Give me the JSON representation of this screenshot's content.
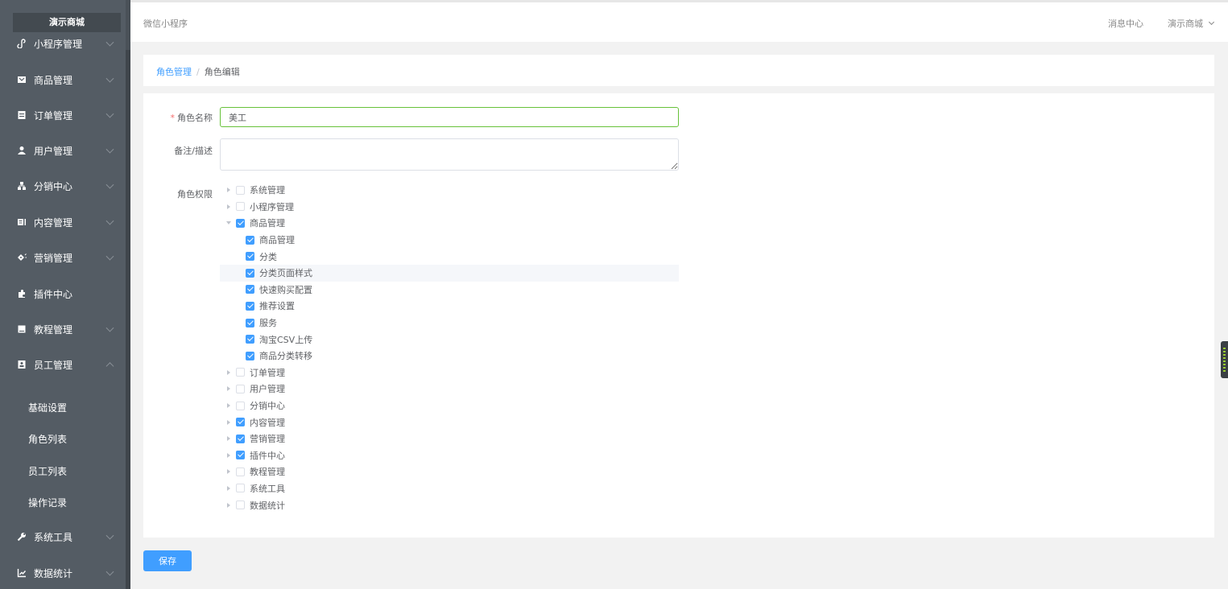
{
  "brand": "演示商城",
  "sidebar": {
    "items": [
      {
        "label": "小程序管理",
        "icon": "mini-program-icon"
      },
      {
        "label": "商品管理",
        "icon": "goods-icon"
      },
      {
        "label": "订单管理",
        "icon": "order-icon"
      },
      {
        "label": "用户管理",
        "icon": "user-icon"
      },
      {
        "label": "分销中心",
        "icon": "distribution-icon"
      },
      {
        "label": "内容管理",
        "icon": "content-icon"
      },
      {
        "label": "营销管理",
        "icon": "marketing-icon"
      },
      {
        "label": "插件中心",
        "icon": "plugin-icon"
      },
      {
        "label": "教程管理",
        "icon": "tutorial-icon"
      },
      {
        "label": "员工管理",
        "icon": "staff-icon"
      }
    ],
    "subitems": [
      "基础设置",
      "角色列表",
      "员工列表",
      "操作记录"
    ],
    "bottom_items": [
      {
        "label": "系统工具",
        "icon": "wrench-icon"
      },
      {
        "label": "数据统计",
        "icon": "chart-icon"
      }
    ]
  },
  "header": {
    "title": "微信小程序",
    "message_center": "消息中心",
    "store": "演示商城"
  },
  "breadcrumb": {
    "parent": "角色管理",
    "separator": "/",
    "current": "角色编辑"
  },
  "form": {
    "name_label": "角色名称",
    "name_required": "*",
    "name_value": "美工",
    "desc_label": "备注/描述",
    "desc_value": "",
    "perm_label": "角色权限"
  },
  "tree": [
    {
      "label": "系统管理",
      "level": 0,
      "expand": "closed",
      "checked": false
    },
    {
      "label": "小程序管理",
      "level": 0,
      "expand": "closed",
      "checked": false
    },
    {
      "label": "商品管理",
      "level": 0,
      "expand": "open",
      "checked": true
    },
    {
      "label": "商品管理",
      "level": 1,
      "expand": "none",
      "checked": true
    },
    {
      "label": "分类",
      "level": 1,
      "expand": "none",
      "checked": true
    },
    {
      "label": "分类页面样式",
      "level": 1,
      "expand": "none",
      "checked": true,
      "highlight": true
    },
    {
      "label": "快速购买配置",
      "level": 1,
      "expand": "none",
      "checked": true
    },
    {
      "label": "推荐设置",
      "level": 1,
      "expand": "none",
      "checked": true
    },
    {
      "label": "服务",
      "level": 1,
      "expand": "none",
      "checked": true
    },
    {
      "label": "淘宝CSV上传",
      "level": 1,
      "expand": "none",
      "checked": true
    },
    {
      "label": "商品分类转移",
      "level": 1,
      "expand": "none",
      "checked": true
    },
    {
      "label": "订单管理",
      "level": 0,
      "expand": "closed",
      "checked": false
    },
    {
      "label": "用户管理",
      "level": 0,
      "expand": "closed",
      "checked": false
    },
    {
      "label": "分销中心",
      "level": 0,
      "expand": "closed",
      "checked": false
    },
    {
      "label": "内容管理",
      "level": 0,
      "expand": "closed",
      "checked": true
    },
    {
      "label": "营销管理",
      "level": 0,
      "expand": "closed",
      "checked": true
    },
    {
      "label": "插件中心",
      "level": 0,
      "expand": "closed",
      "checked": true
    },
    {
      "label": "教程管理",
      "level": 0,
      "expand": "closed",
      "checked": false
    },
    {
      "label": "系统工具",
      "level": 0,
      "expand": "closed",
      "checked": false
    },
    {
      "label": "数据统计",
      "level": 0,
      "expand": "closed",
      "checked": false
    }
  ],
  "save_label": "保存"
}
